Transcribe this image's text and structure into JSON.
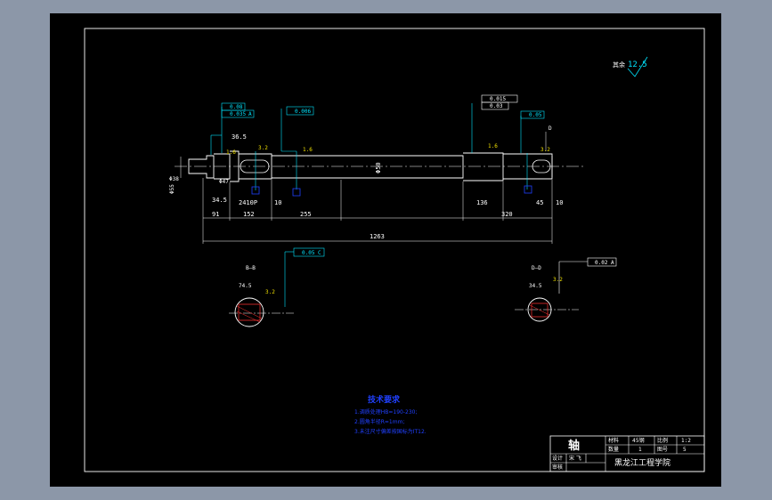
{
  "surface_finish": {
    "label": "其余",
    "value": "12.5"
  },
  "main_view": {
    "dims": {
      "overall": "1263",
      "d91": "91",
      "d152": "152",
      "d255": "255",
      "d10": "10",
      "d136": "136",
      "d320": "320",
      "d45": "45",
      "d34_5": "34.5",
      "d2410": "2410P",
      "d36_5": "36.5",
      "d_phi38": "Φ38",
      "d_phi55": "Φ55",
      "d_phi47": "Φ47",
      "d_phi": "Φ",
      "d50": "Φ50",
      "d35": "Φ35"
    },
    "tolerances": {
      "t1a": "0.08",
      "t1b": "0.035",
      "t1c": "A",
      "t2": "0.006",
      "t3a": "0.015",
      "t3b": "0.03",
      "t3c": "0.05",
      "datum_d": "D"
    },
    "roughness": {
      "r1": "1.6",
      "r2": "3.2",
      "r3": "1.6",
      "r4": "1.6",
      "r5": "3.2"
    },
    "markers": {
      "m1": "B",
      "m2": "E"
    }
  },
  "section_b": {
    "label": "B—B",
    "tol": "0.05",
    "tol_datum": "C",
    "dim1": "74.5",
    "rough": "3.2"
  },
  "section_d": {
    "label": "D—D",
    "tol": "0.02",
    "tol_datum": "A",
    "dim1": "34.5",
    "rough": "3.2"
  },
  "tech_req": {
    "title": "技术要求",
    "items": [
      "1.调质处理HB=190-230;",
      "2.圆角半径R=1mm;",
      "3.未注尺寸偏差按国标为IT12."
    ]
  },
  "title_block": {
    "part_name": "轴",
    "material_label": "材料",
    "material": "45钢",
    "scale_label": "比例",
    "scale": "1:2",
    "qty_label": "数量",
    "qty": "1",
    "drawing_no_label": "图号",
    "drawing_no": "5",
    "design_label": "设计",
    "designer": "宋 飞",
    "review_label": "审核",
    "school": "黑龙江工程学院"
  },
  "colors": {
    "outer_bg": "#8c97a8",
    "sheet": "#000000",
    "line": "#ffffff",
    "cyan": "#00e5ff",
    "red": "#ff3030",
    "blue": "#2040ff",
    "yellow": "#f0e000"
  }
}
